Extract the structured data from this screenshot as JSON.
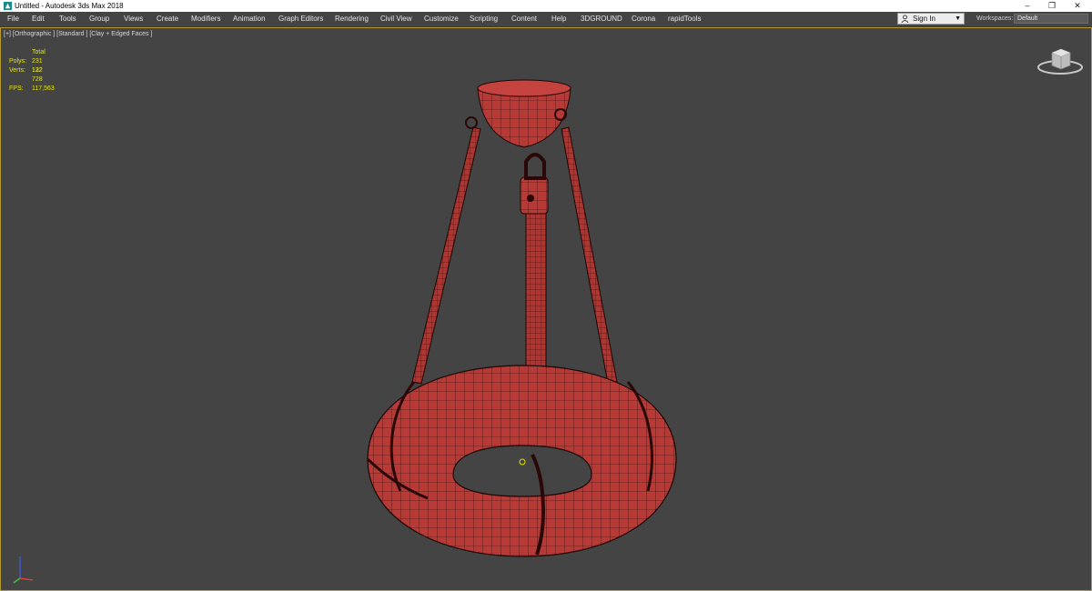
{
  "window": {
    "title": "Untitled - Autodesk 3ds Max 2018",
    "controls": [
      "–",
      "❐",
      "✕"
    ]
  },
  "menu": {
    "items": [
      "File",
      "Edit",
      "Tools",
      "Group",
      "Views",
      "Create",
      "Modifiers",
      "Animation",
      "Graph Editors",
      "Rendering",
      "Civil View",
      "Customize",
      "Scripting",
      "Content",
      "Help",
      "3DGROUND",
      "Corona",
      "rapidTools"
    ]
  },
  "account": {
    "sign_in": "Sign In",
    "workspaces_label": "Workspaces:",
    "workspace_value": "Default"
  },
  "viewport": {
    "label": "[+] [Orthographic ] [Standard ] [Clay + Edged Faces ]",
    "stats": {
      "total_label": "Total",
      "polys_label": "Polys:",
      "polys_value": "231 132",
      "verts_label": "Verts:",
      "verts_value": "122 728",
      "fps_label": "FPS:",
      "fps_value": "117,563"
    }
  },
  "colors": {
    "viewport_bg": "#444444",
    "model_clay": "#b83a36",
    "wire": "#2a0807",
    "stats_yellow": "#e6e600",
    "active_border": "#b59c2a"
  },
  "icons": {
    "app": "3ds-max-icon",
    "user": "user-icon",
    "viewcube": "viewcube-icon",
    "axis": "axis-tripod-icon"
  }
}
